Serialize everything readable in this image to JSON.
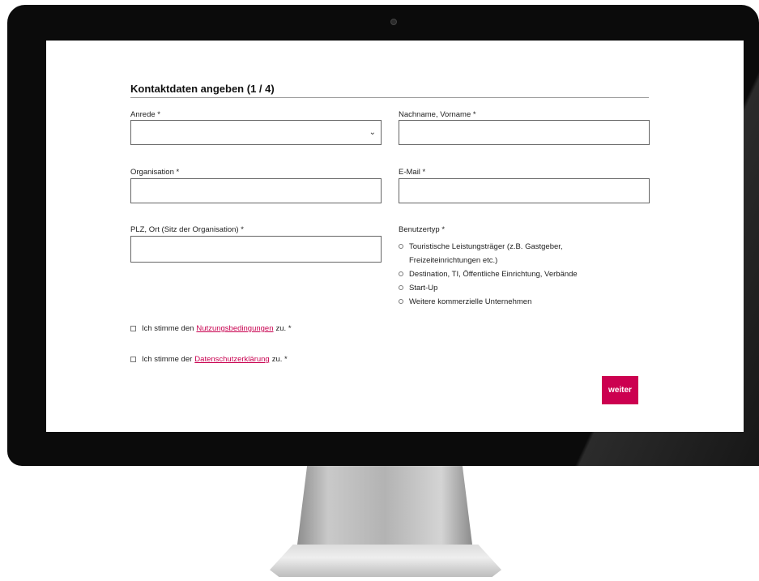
{
  "form": {
    "title": "Kontaktdaten angeben (1 / 4)",
    "anrede_label": "Anrede *",
    "name_label": "Nachname, Vorname *",
    "organisation_label": "Organisation *",
    "email_label": "E-Mail *",
    "plz_label": "PLZ, Ort (Sitz der Organisation) *",
    "usertype_label": "Benutzertyp *",
    "usertype_options": [
      "Touristische Leistungsträger (z.B. Gastgeber, Freizeiteinrichtungen etc.)",
      "Destination, TI, Öffentliche Einrichtung, Verbände",
      "Start-Up",
      "Weitere kommerzielle Unternehmen"
    ],
    "terms_prefix": "Ich stimme den",
    "terms_link": "Nutzungsbedingungen",
    "terms_suffix": "zu. *",
    "privacy_prefix": "Ich stimme der",
    "privacy_link": "Datenschutzerklärung",
    "privacy_suffix": "zu. *",
    "next_label": "weiter"
  },
  "colors": {
    "accent": "#cc0050",
    "link": "#c8004f",
    "bezel": "#0b0b0b"
  }
}
